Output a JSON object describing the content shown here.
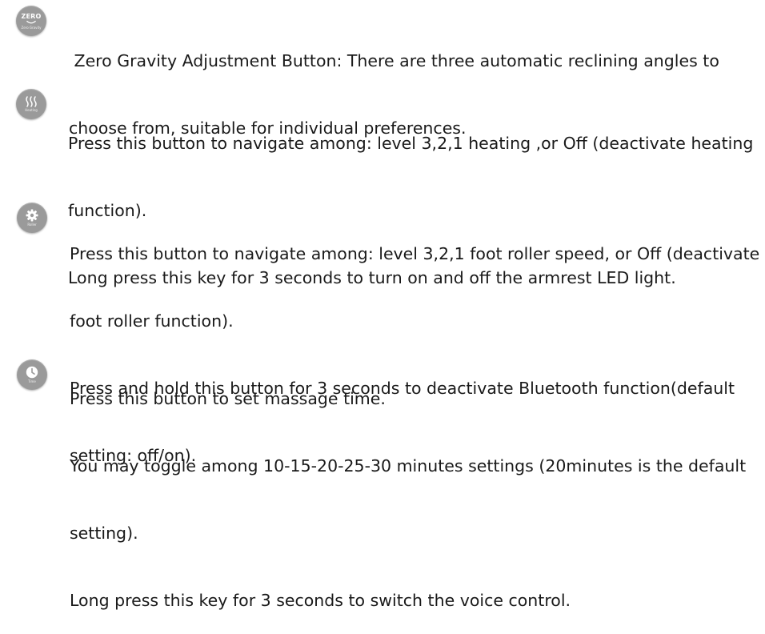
{
  "items": [
    {
      "icon": "zero-gravity-icon",
      "icon_label_top": "ZERO",
      "icon_caption": "Zero Gravity",
      "lines": [
        " Zero Gravity Adjustment Button: There are three automatic reclining angles to",
        "choose from, suitable for individual preferences."
      ]
    },
    {
      "icon": "heating-icon",
      "icon_caption": "Heating",
      "lines": [
        "Press this button to navigate among: level 3,2,1 heating ,or Off (deactivate heating",
        "function).",
        "Long press this key for 3 seconds to turn on and off the armrest LED light."
      ]
    },
    {
      "icon": "roller-gear-icon",
      "icon_caption": "Roller",
      "lines": [
        "Press this button to navigate among: level 3,2,1 foot roller speed, or Off (deactivate",
        "foot roller function).",
        "Press and hold this button for 3 seconds to deactivate Bluetooth function(default",
        "setting: off/on)."
      ]
    },
    {
      "icon": "clock-icon",
      "icon_caption": "Time",
      "lines": [
        "Press this button to set massage time.",
        "You may toggle among 10-15-20-25-30 minutes settings (20minutes is the default",
        "setting).",
        "Long press this key for 3 seconds to switch the voice control."
      ]
    }
  ],
  "colors": {
    "icon_bg": "#9a9a9a",
    "icon_fg": "#ffffff",
    "text": "#1a1a1a"
  }
}
